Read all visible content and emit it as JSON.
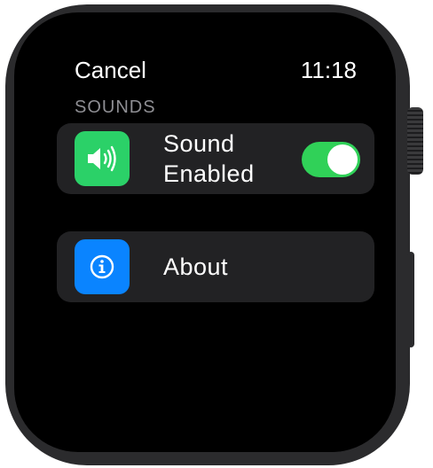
{
  "status_bar": {
    "cancel_label": "Cancel",
    "time": "11:18"
  },
  "section": {
    "header": "SOUNDS"
  },
  "rows": [
    {
      "label": "Sound Enabled",
      "icon": "speaker-icon",
      "icon_color": "#2bd168",
      "toggle": {
        "state": "on",
        "color": "#30d158"
      }
    },
    {
      "label": "About",
      "icon": "info-icon",
      "icon_color": "#0a84ff"
    }
  ],
  "colors": {
    "background": "#000000",
    "row_background": "#222224",
    "section_header": "#8e8e93",
    "text": "#ffffff"
  }
}
